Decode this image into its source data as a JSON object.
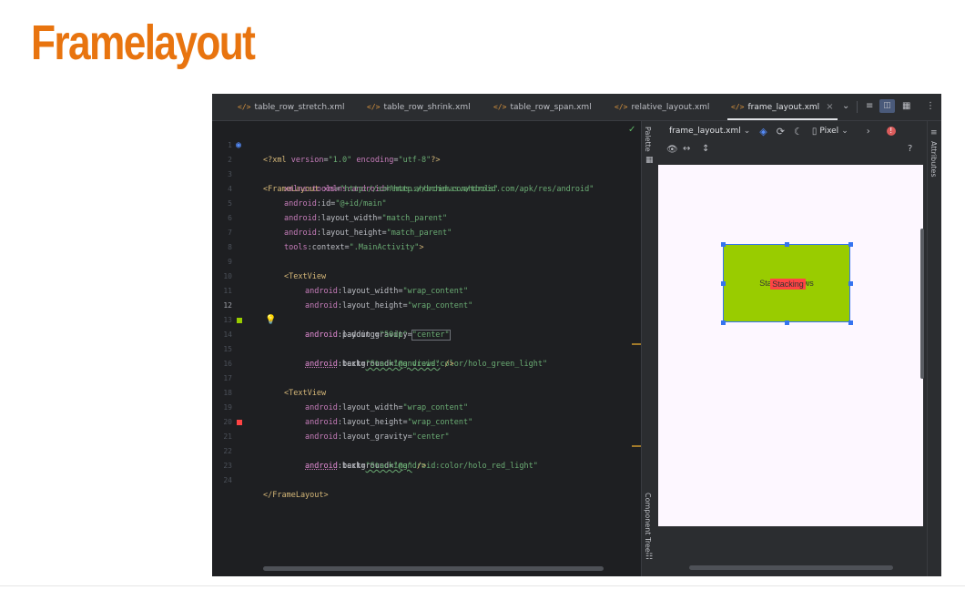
{
  "slide_title": "Framelayout",
  "tabs": [
    {
      "label": "table_row_stretch.xml"
    },
    {
      "label": "table_row_shrink.xml"
    },
    {
      "label": "table_row_span.xml"
    },
    {
      "label": "relative_layout.xml"
    },
    {
      "label": "frame_layout.xml",
      "active": true,
      "close": "×"
    }
  ],
  "line_numbers": [
    "1",
    "2",
    "3",
    "4",
    "5",
    "6",
    "7",
    "8",
    "9",
    "10",
    "11",
    "12",
    "13",
    "14",
    "15",
    "16",
    "17",
    "18",
    "19",
    "20",
    "21",
    "22",
    "23",
    "24"
  ],
  "current_line": "12",
  "code": {
    "l1_a": "<?xml ",
    "l1_b": "version",
    "l1_c": "=",
    "l1_d": "\"1.0\"",
    "l1_e": " encoding",
    "l1_f": "=",
    "l1_g": "\"utf-8\"",
    "l1_h": "?>",
    "l2_a": "<FrameLayout ",
    "l2_b": "xmlns:android",
    "l2_c": "=",
    "l2_d": "\"http://schemas.android.com/apk/res/android\"",
    "l3_a": "xmlns:tools",
    "l3_b": "=",
    "l3_c": "\"http://schemas.android.com/tools\"",
    "l4_a": "android",
    "l4_b": ":id=",
    "l4_c": "\"@+id/main\"",
    "l5_a": "android",
    "l5_b": ":layout_width=",
    "l5_c": "\"match_parent\"",
    "l6_a": "android",
    "l6_b": ":layout_height=",
    "l6_c": "\"match_parent\"",
    "l7_a": "tools",
    "l7_b": ":context=",
    "l7_c": "\".MainActivity\"",
    "l7_d": ">",
    "l9_a": "<TextView",
    "l10_a": "android",
    "l10_b": ":layout_width=",
    "l10_c": "\"wrap_content\"",
    "l11_a": "android",
    "l11_b": ":layout_height=",
    "l11_c": "\"wrap_content\"",
    "l12_a": "android",
    "l12_b": ":layout_gravity=",
    "l12_c": "\"center\"",
    "l13_a": "android",
    "l13_b": ":padding=",
    "l13_c": "\"50dp\"",
    "l14_a": "android",
    "l14_b": ":background=",
    "l14_c": "\"@android:color/holo_green_light\"",
    "l15_a": "android",
    "l15_b": ":text=",
    "l15_c": "\"Stacking views\"",
    "l15_d": " />",
    "l17_a": "<TextView",
    "l18_a": "android",
    "l18_b": ":layout_width=",
    "l18_c": "\"wrap_content\"",
    "l19_a": "android",
    "l19_b": ":layout_height=",
    "l19_c": "\"wrap_content\"",
    "l20_a": "android",
    "l20_b": ":layout_gravity=",
    "l20_c": "\"center\"",
    "l21_a": "android",
    "l21_b": ":background=",
    "l21_c": "\"@android:color/holo_red_light\"",
    "l22_a": "android",
    "l22_b": ":text=",
    "l22_c": "\"Stacking\"",
    "l22_d": " />",
    "l24_a": "</FrameLayout>"
  },
  "gutter_colors": {
    "holo_green_light": "#99cc00",
    "holo_red_light": "#ff4444"
  },
  "design_toolbar": {
    "file": "frame_layout.xml",
    "device": "Pixel",
    "help": "?"
  },
  "side_panels": {
    "palette": "Palette",
    "component_tree": "Component Tree",
    "attributes": "Attributes"
  },
  "preview": {
    "green_text": "Stacking views",
    "red_text": "Stacking",
    "green_color": "#99cc00",
    "red_color": "#ff4444"
  },
  "accent_color": "#e8740f"
}
